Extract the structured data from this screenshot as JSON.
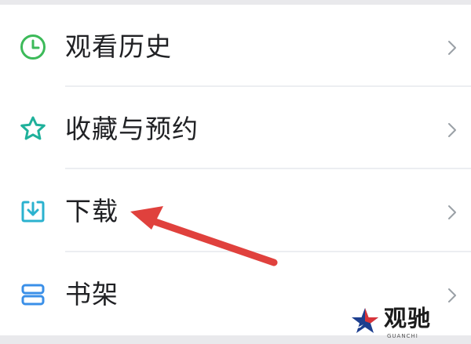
{
  "menu": {
    "items": [
      {
        "label": "观看历史",
        "icon": "clock-icon",
        "icon_color": "#3cba59"
      },
      {
        "label": "收藏与预约",
        "icon": "star-icon",
        "icon_color": "#1fb19b"
      },
      {
        "label": "下载",
        "icon": "download-icon",
        "icon_color": "#2bb2cf"
      },
      {
        "label": "书架",
        "icon": "bookshelf-icon",
        "icon_color": "#3a8fe8"
      }
    ]
  },
  "annotation": {
    "arrow_color": "#e0413d"
  },
  "watermark": {
    "name": "观驰",
    "sub": "GUANCHI"
  }
}
